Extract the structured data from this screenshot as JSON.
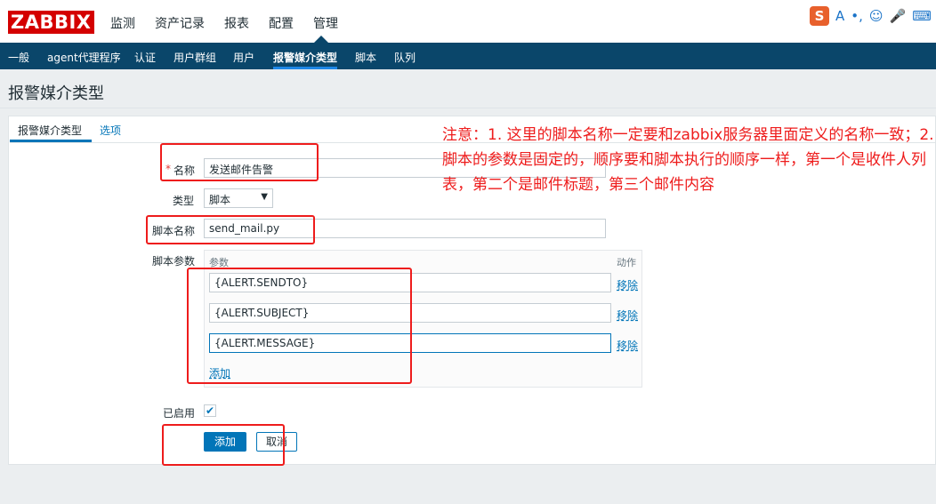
{
  "logo": "ZABBIX",
  "main_nav": [
    "监测",
    "资产记录",
    "报表",
    "配置",
    "管理"
  ],
  "sub_nav": [
    "一般",
    "agent代理程序",
    "认证",
    "用户群组",
    "用户",
    "报警媒介类型",
    "脚本",
    "队列"
  ],
  "ime_icons": [
    "S",
    "A",
    "•,",
    "☺",
    "🎤",
    "⌨"
  ],
  "page_title": "报警媒介类型",
  "tabs": [
    "报警媒介类型",
    "选项"
  ],
  "form": {
    "name_label": "名称",
    "name_required": "*",
    "name_value": "发送邮件告警",
    "type_label": "类型",
    "type_value": "脚本",
    "script_name_label": "脚本名称",
    "script_name_value": "send_mail.py",
    "params_label": "脚本参数",
    "params_col_header": "参数",
    "action_col_header": "动作",
    "params": [
      {
        "value": "{ALERT.SENDTO}",
        "remove": "移除"
      },
      {
        "value": "{ALERT.SUBJECT}",
        "remove": "移除"
      },
      {
        "value": "{ALERT.MESSAGE}",
        "remove": "移除"
      }
    ],
    "add_param_link": "添加",
    "enabled_label": "已启用",
    "enabled": true,
    "add_button": "添加",
    "cancel_button": "取消"
  },
  "annotation": "注意：1. 这里的脚本名称一定要和zabbix服务器里面定义的名称一致；2.  脚本的参数是固定的，顺序要和脚本执行的顺序一样，第一个是收件人列表，第二个是邮件标题，第三个邮件内容",
  "colors": {
    "brand_red": "#d40000",
    "subnav_bg": "#0a466a",
    "accent_blue": "#0275b8",
    "annotation_red": "#ee1c1c"
  }
}
